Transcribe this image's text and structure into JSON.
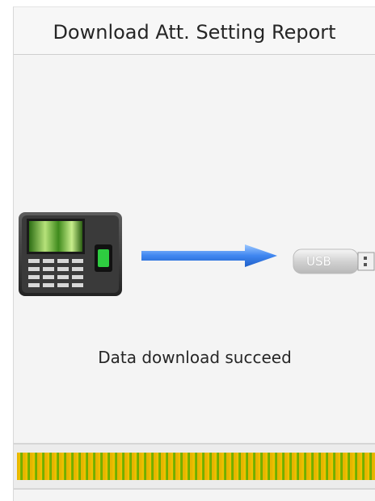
{
  "header": {
    "title": "Download Att. Setting Report"
  },
  "transfer": {
    "source_icon": "attendance-terminal-icon",
    "arrow_icon": "right-arrow-icon",
    "target_icon": "usb-drive-icon",
    "usb_label": "USB"
  },
  "status": {
    "message": "Data download succeed"
  },
  "progress": {
    "fraction": 1.0
  },
  "colors": {
    "background": "#f4f4f4",
    "arrow": "#3f86f0",
    "progress_yellow": "#f0c400",
    "progress_green": "#7fb800"
  }
}
